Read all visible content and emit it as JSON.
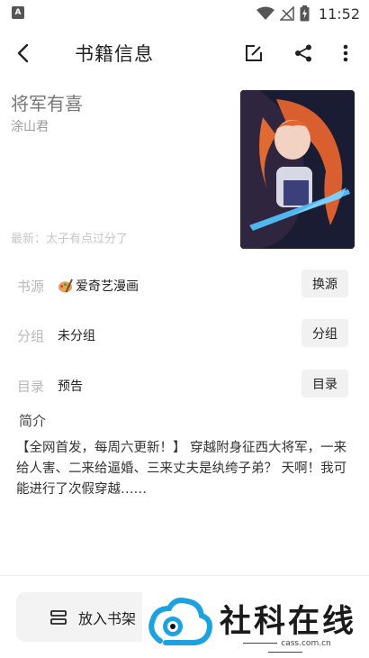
{
  "status_bar": {
    "app_icon_letter": "A",
    "time": "11:52"
  },
  "toolbar": {
    "title": "书籍信息",
    "icons": [
      "back-arrow-icon",
      "edit-icon",
      "share-icon",
      "more-vert-icon"
    ]
  },
  "book": {
    "title": "将军有喜",
    "author": "涂山君",
    "latest": "最新：太子有点过分了"
  },
  "rows": {
    "source": {
      "label": "书源",
      "value": "爱奇艺漫画",
      "button": "换源"
    },
    "group": {
      "label": "分组",
      "value": "未分组",
      "button": "分组"
    },
    "toc": {
      "label": "目录",
      "value": "预告",
      "button": "目录"
    }
  },
  "intro": {
    "label": "简介",
    "text": "【全网首发，每周六更新！】 穿越附身征西大将军，一来给人害、二来给逼婚、三来丈夫是纨绔子弟？ 天啊！我可能进行了次假穿越……"
  },
  "bottom": {
    "shelf_label": "放入书架"
  },
  "watermark": {
    "text": "社科在线",
    "sub": "cass.com.cn"
  },
  "colors": {
    "accent": "#1aa3e0",
    "button_bg": "#f1f1f1"
  }
}
